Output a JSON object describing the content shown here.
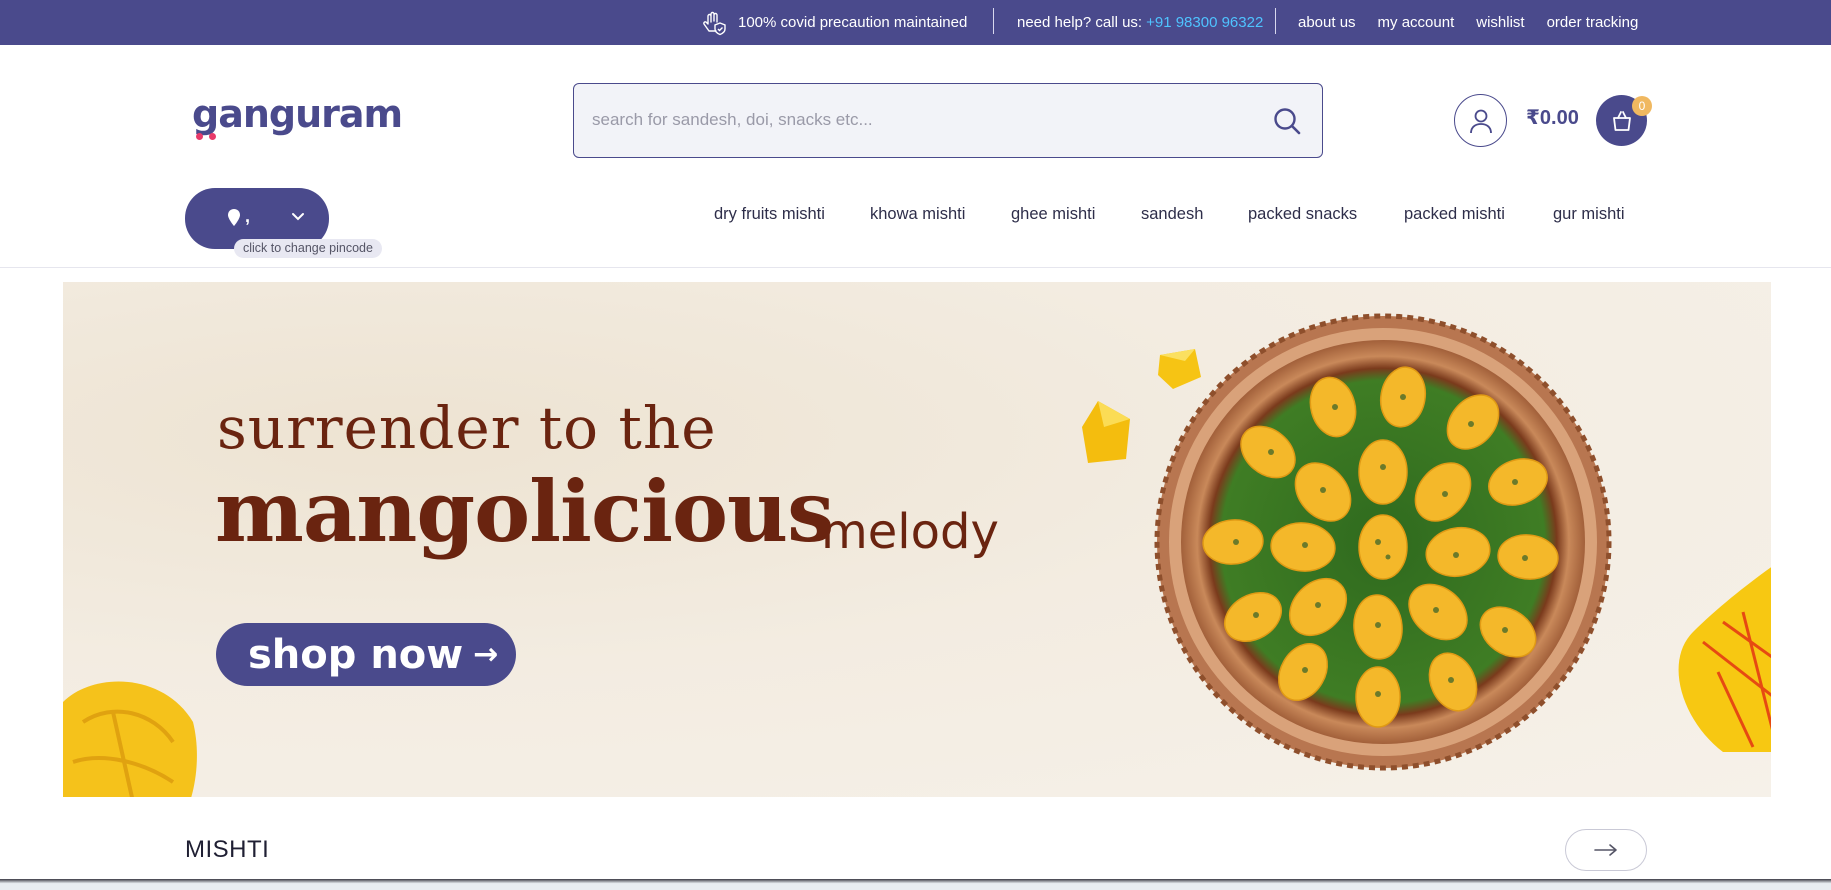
{
  "topbar": {
    "covid_text": "100% covid precaution maintained",
    "help_text": "need help? call us:",
    "phone": "+91 98300 96322",
    "links": [
      "about us",
      "my account",
      "wishlist",
      "order tracking"
    ]
  },
  "header": {
    "logo_text": "ganguram",
    "search_placeholder": "search for sandesh, doi, snacks etc...",
    "cart_total": "₹0.00",
    "cart_count": "0"
  },
  "location": {
    "value": ",",
    "hint": "click to change pincode"
  },
  "nav": {
    "items": [
      "dry fruits mishti",
      "khowa mishti",
      "ghee mishti",
      "sandesh",
      "packed snacks",
      "packed mishti",
      "gur mishti"
    ]
  },
  "banner": {
    "line1": "surrender to the",
    "line2": "mangolicious",
    "line3": "melody",
    "cta": "shop now",
    "cta_arrow": "→"
  },
  "section": {
    "title": "MISHTI"
  },
  "colors": {
    "brand": "#4a4a8c",
    "accent_phone": "#4fc3ff",
    "banner_text": "#6a2410",
    "badge": "#f0b860"
  }
}
